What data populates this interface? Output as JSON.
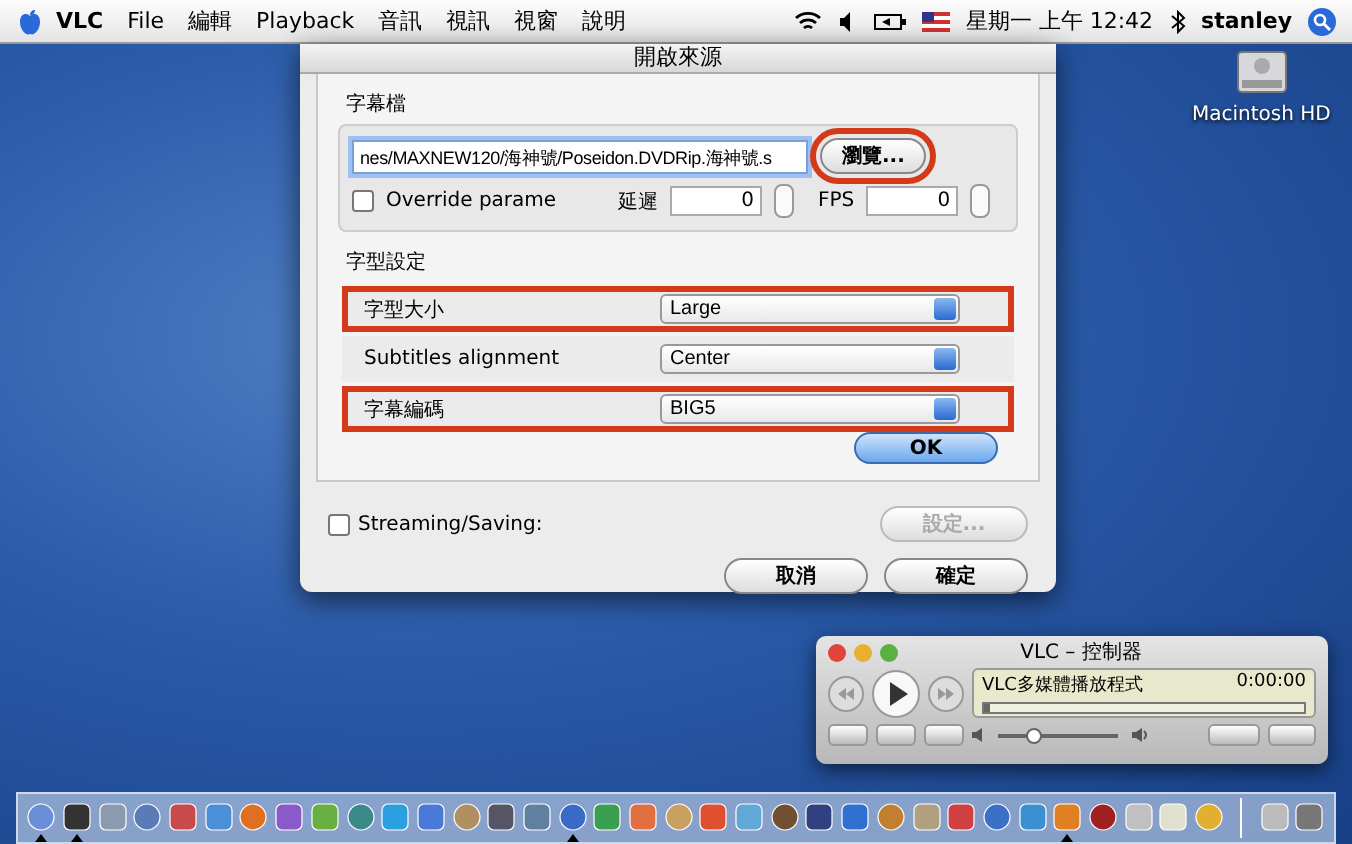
{
  "menubar": {
    "items": [
      "VLC",
      "File",
      "編輯",
      "Playback",
      "音訊",
      "視訊",
      "視窗",
      "說明"
    ],
    "clock": "星期一 上午 12:42",
    "user": "stanley"
  },
  "desktop_icons": [
    {
      "label": "Macintosh HD"
    }
  ],
  "dialog": {
    "title": "開啟來源",
    "subtitle_group": {
      "title": "字幕檔",
      "path": "nes/MAXNEW120/海神號/Poseidon.DVDRip.海神號.s",
      "browse": {
        "label": "瀏覽...",
        "highlighted": true
      },
      "override": {
        "label": "Override parame",
        "checked": false
      },
      "delay": {
        "label": "延遲",
        "value": "0"
      },
      "fps": {
        "label": "FPS",
        "value": "0"
      }
    },
    "font_group": {
      "title": "字型設定",
      "rows": [
        {
          "label": "字型大小",
          "value": "Large",
          "highlighted": true
        },
        {
          "label": "Subtitles alignment",
          "value": "Center",
          "highlighted": false
        },
        {
          "label": "字幕編碼",
          "value": "BIG5",
          "highlighted": true
        }
      ]
    },
    "ok": "OK",
    "streaming": {
      "label": "Streaming/Saving:",
      "checked": false
    },
    "settings": {
      "label": "設定...",
      "disabled": true
    },
    "buttons": [
      {
        "label": "取消"
      },
      {
        "label": "確定"
      }
    ]
  },
  "controller": {
    "title": "VLC – 控制器",
    "status": "VLC多媒體播放程式",
    "time": "0:00:00",
    "seek": {
      "level": 0
    },
    "volume": {
      "level": 0.3
    }
  },
  "dock": {
    "items": [
      {
        "running": true
      },
      {
        "running": true
      },
      {
        "running": false
      },
      {
        "running": false
      },
      {
        "running": false
      },
      {
        "running": false
      },
      {
        "running": false
      },
      {
        "running": false
      },
      {
        "running": false
      },
      {
        "running": false
      },
      {
        "running": false
      },
      {
        "running": false
      },
      {
        "running": false
      },
      {
        "running": false
      },
      {
        "running": false
      },
      {
        "running": true
      },
      {
        "running": false
      },
      {
        "running": false
      },
      {
        "running": false
      },
      {
        "running": false
      },
      {
        "running": false
      },
      {
        "running": false
      },
      {
        "running": false
      },
      {
        "running": false
      },
      {
        "running": false
      },
      {
        "running": false
      },
      {
        "running": false
      },
      {
        "running": false
      },
      {
        "running": false
      },
      {
        "running": true
      },
      {
        "running": false
      },
      {
        "running": false
      },
      {
        "running": false
      },
      {
        "running": false
      }
    ],
    "extras": [
      {
        "running": false
      },
      {
        "running": false
      }
    ]
  }
}
